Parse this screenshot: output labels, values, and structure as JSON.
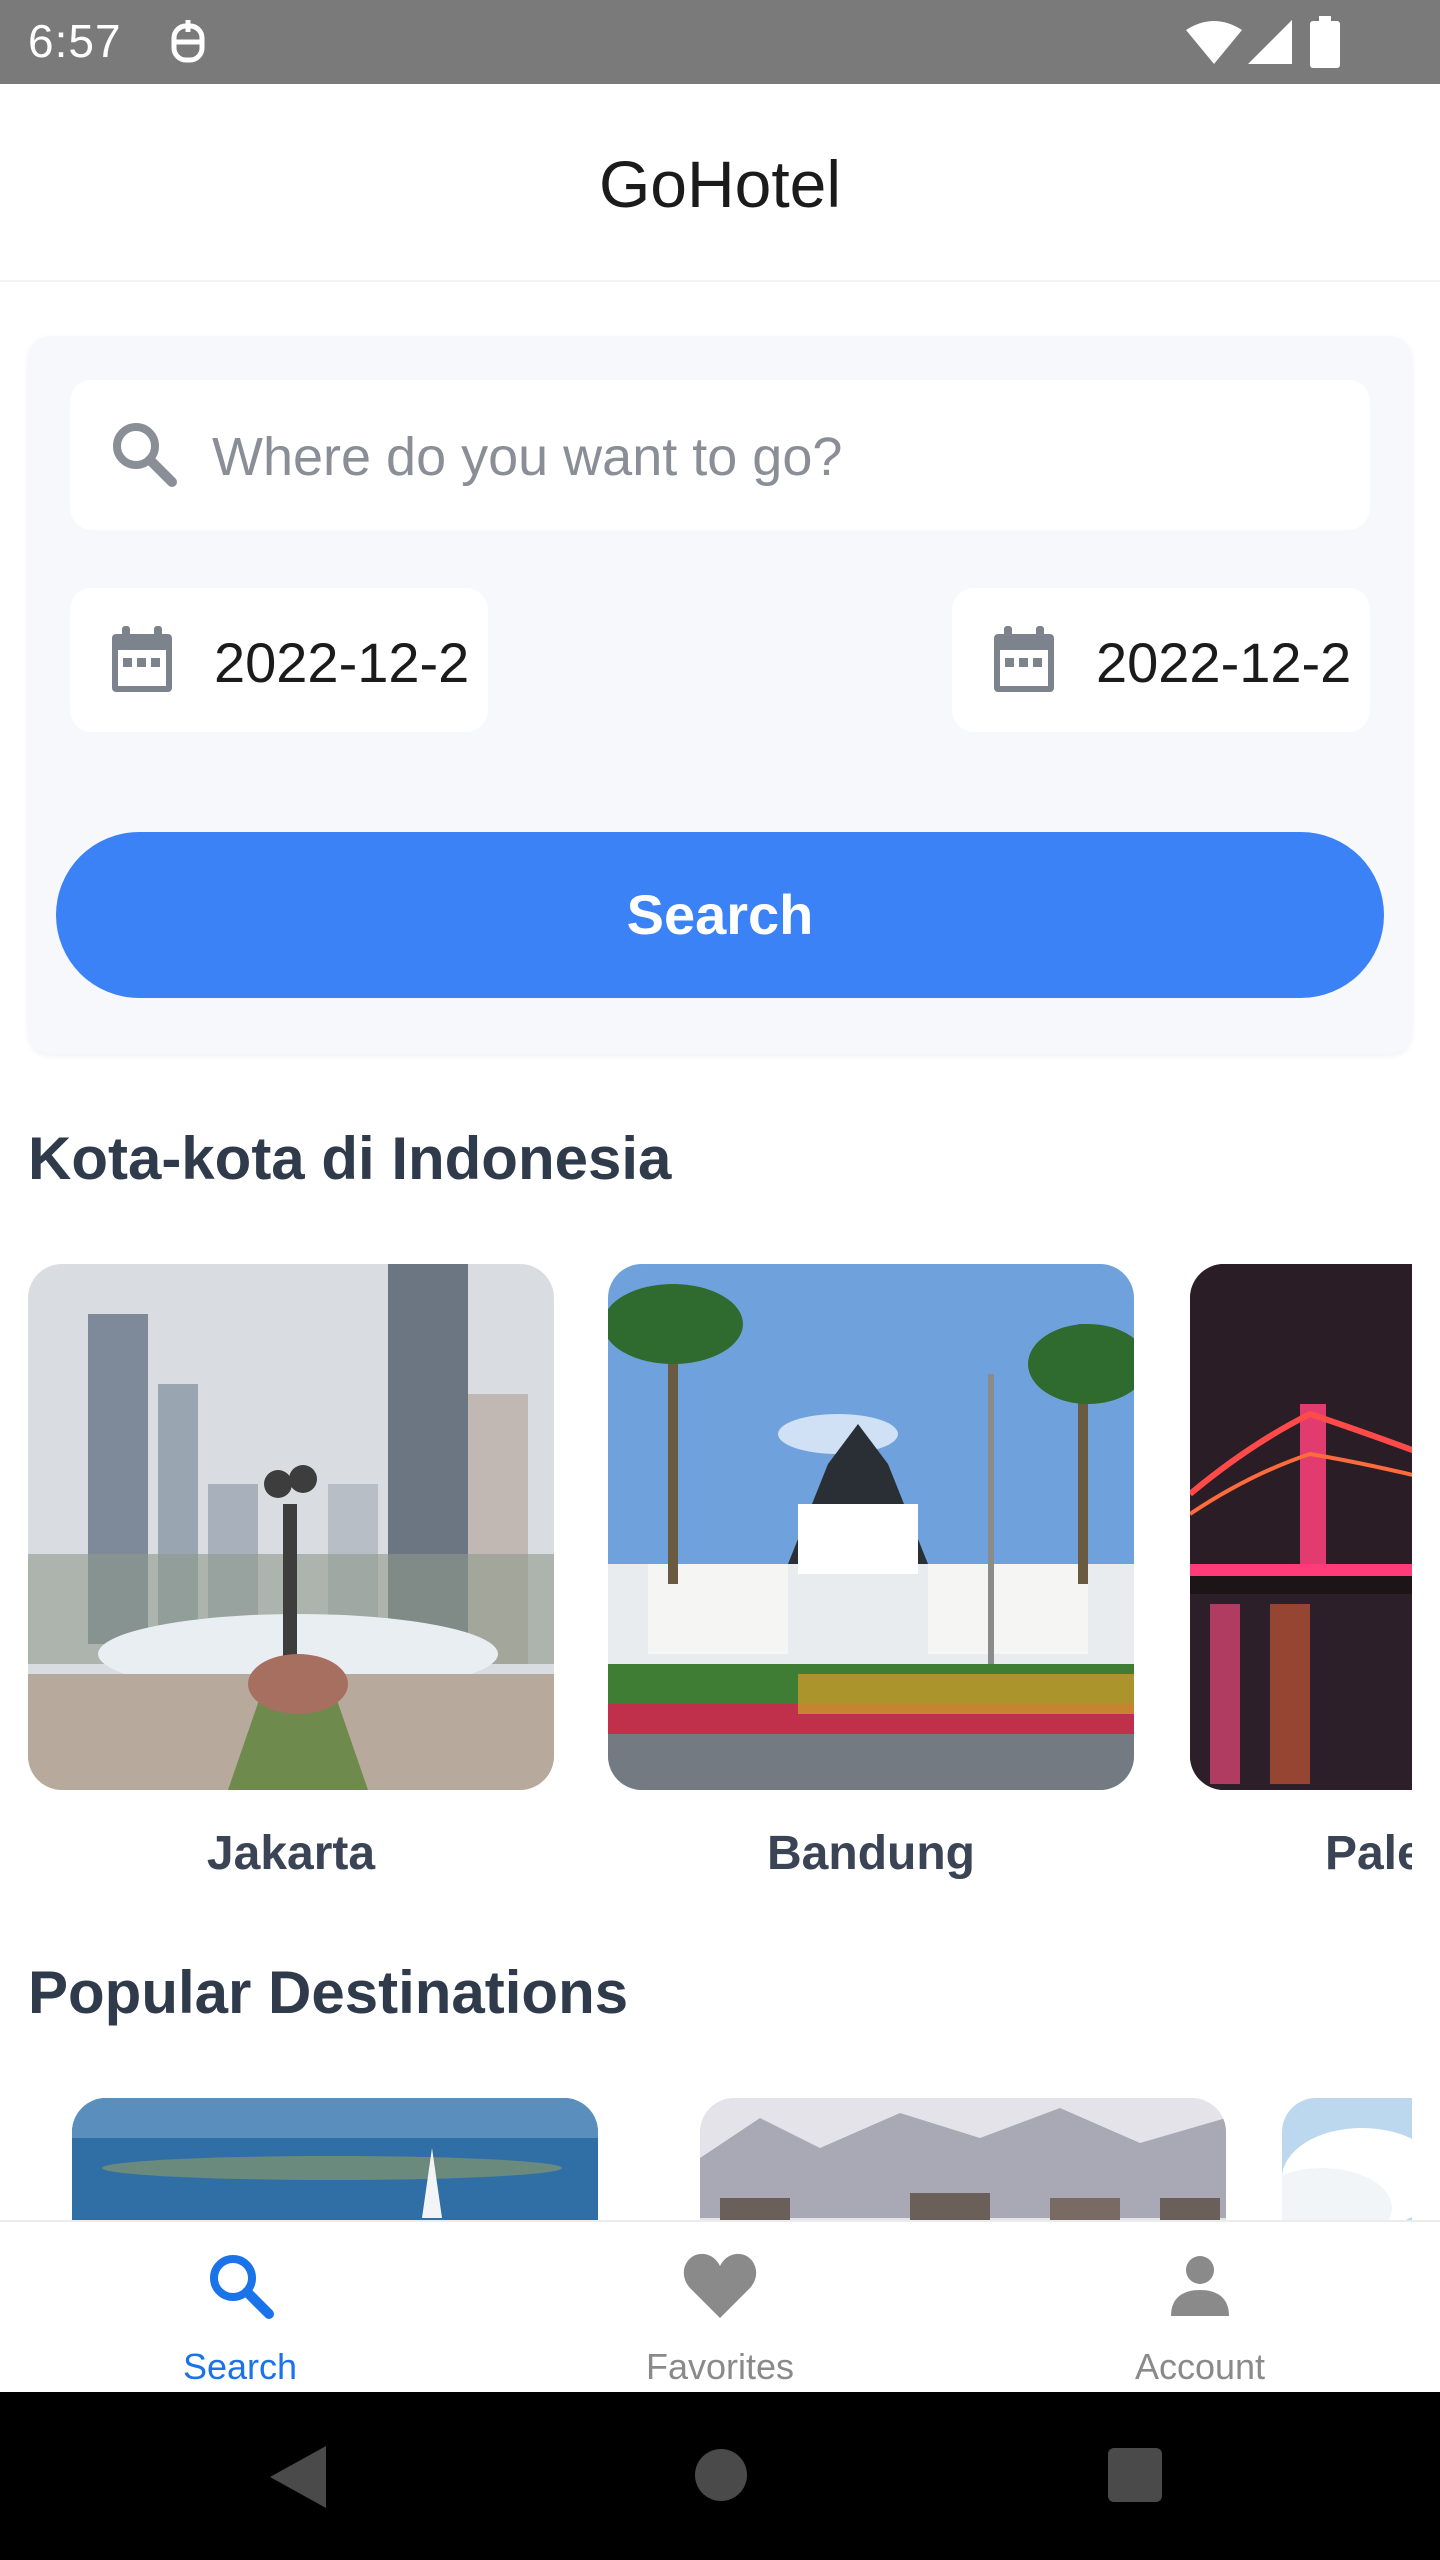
{
  "status_bar": {
    "time": "6:57"
  },
  "app_bar": {
    "title": "GoHotel"
  },
  "search": {
    "placeholder": "Where do you want to go?",
    "check_in": "2022-12-2",
    "check_out": "2022-12-2",
    "button_label": "Search"
  },
  "cities_section": {
    "title": "Kota-kota di Indonesia",
    "items": [
      {
        "label": "Jakarta"
      },
      {
        "label": "Bandung"
      },
      {
        "label": "Palembang"
      }
    ]
  },
  "popular_section": {
    "title": "Popular Destinations"
  },
  "bottom_nav": {
    "items": [
      {
        "label": "Search",
        "icon": "search-icon",
        "active": true
      },
      {
        "label": "Favorites",
        "icon": "heart-icon",
        "active": false
      },
      {
        "label": "Account",
        "icon": "person-icon",
        "active": false
      }
    ],
    "active_color": "#1a73e8",
    "inactive_color": "#8a8a8a"
  },
  "colors": {
    "accent": "#3b82f6",
    "heading": "#2f3a4a"
  }
}
